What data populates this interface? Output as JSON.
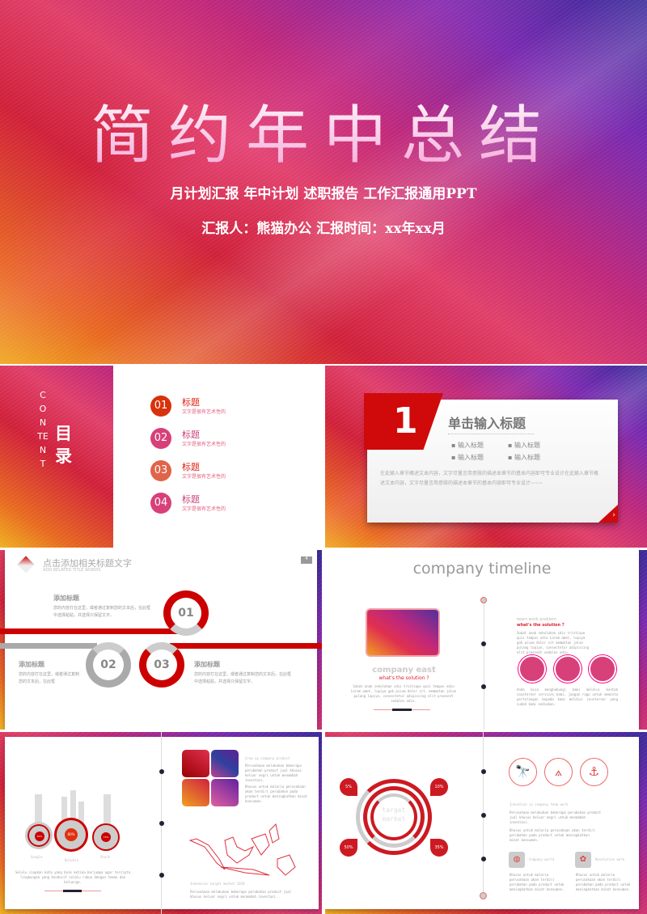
{
  "cover": {
    "title": "简约年中总结",
    "subtitle": "月计划汇报 年中计划 述职报告 工作汇报通用PPT",
    "reporter": "汇报人：熊猫办公 汇报时间：xx年xx月"
  },
  "toc": {
    "vertical_en": "CONTENT",
    "title": "目录",
    "items": [
      {
        "num": "01",
        "title": "标题",
        "desc": "文字是很有艺术性的",
        "color": "#d8320c"
      },
      {
        "num": "02",
        "title": "标题",
        "desc": "文字是很有艺术性的",
        "color": "#d8407a"
      },
      {
        "num": "03",
        "title": "标题",
        "desc": "文字是很有艺术性的",
        "color": "#e0644a"
      },
      {
        "num": "04",
        "title": "标题",
        "desc": "文字是很有艺术性的",
        "color": "#d8407a"
      }
    ]
  },
  "section": {
    "num": "1",
    "title": "单击输入标题",
    "bullets": [
      "输入标题",
      "输入标题",
      "输入标题",
      "输入标题"
    ],
    "body": "在此输入章节概述文本内容，文字尽量言简意赅的描述本章节的基本内容即可专业设计在此输入章节概述文本内容，文字尽量言简意赅的描述本章节的基本内容即可专业设计~~~"
  },
  "steps": {
    "title": "点击添加相关标题文字",
    "subtitle": "ADD RELATED TITLE WORDS",
    "page": "4",
    "items": [
      {
        "num": "01",
        "title": "添加标题",
        "text": "您的内容打在这里，或者通过复制您的文本后，在此框中选择粘贴，并选择只保留文字。"
      },
      {
        "num": "02",
        "title": "添加标题",
        "text": "您的内容打在这里，或者通过复制您的文本后，在此框"
      },
      {
        "num": "03",
        "title": "添加标题",
        "text": "您的内容打在这里，或者通过复制您的文本后，在此框中选择粘贴，并选择只保留文字。"
      }
    ]
  },
  "timeline": {
    "title": "company timeline",
    "left_heading": "company east",
    "left_sub": "what's the solution ?",
    "left_text": "Sobat anak sekolahan sdis tristique quis tempus odio Lorem amet, lopiya gak pisum dolor sit. memmatan jalan pulang lopiyo, consectetur adipiscing elit praesent sodales odio.",
    "right_heading": "team work problem",
    "right_sub": "what's the solution ?",
    "right_text": "Sobat anak sekolahan sdis tristique quis tempus odio Lorem amet, lopiya gak pisum dolor sit memmatan jalan pulang lopiyo, consectetur adipiscing elit praesent sodales odio.",
    "right_text2": "Anda bisa menghubungi kami melalui kontak cousterner services kami, jangan ragu untuk meminta pertolongan kepada kami melalui cousterner yang sudah kami sediakan.",
    "accent": "#d8407a"
  },
  "stats": {
    "gauges": [
      {
        "value": "60%",
        "label": "Google"
      },
      {
        "value": "80%",
        "label": "Dolphin"
      },
      {
        "value": "75%",
        "label": "Shark"
      }
    ],
    "text": "Selalu siapkan kata yang baik ketika berjumpa agar tercipta lingkungan yang kondusif selalu rukun dengan teman dan keluarga.",
    "product_heading": "Grow up company product",
    "product_text": "Perusahaan melakukan beberapa perubahan product jual khusus keluar negri untuk menambah investasi.",
    "product_text2": "Khusus untuk malaria perusahaan akan terdiri perubahan pada product untuk meningkatkan minat konsumen.",
    "map_heading": "Indonesia target market 2018",
    "map_text": "Perusahaan melakukan beberapa perubahan product jual khusus keluar negri untuk menambah investasi."
  },
  "market": {
    "center": "target market",
    "badges": [
      "5%",
      "10%",
      "50%",
      "35%"
    ],
    "heading": "Inovation in company team work",
    "text": "Perusahaan melakukan beberapa perubahan product jual khusus keluar negri untuk menambah investasi.",
    "text2": "Khusus untuk malaria perusahaan akan terdiri perubahan pada product untuk meningkatkan minat konsumen.",
    "feature1": "Company world",
    "feature2": "Revolution work",
    "feature_text": "Khusus untuk malaria perusahaan akan terdiri perubahan pada product untuk meningkatkan minat konsumen.",
    "icons": [
      "telescope-icon",
      "compass-icon",
      "anchor-icon"
    ],
    "accent": "#cc1a22"
  }
}
